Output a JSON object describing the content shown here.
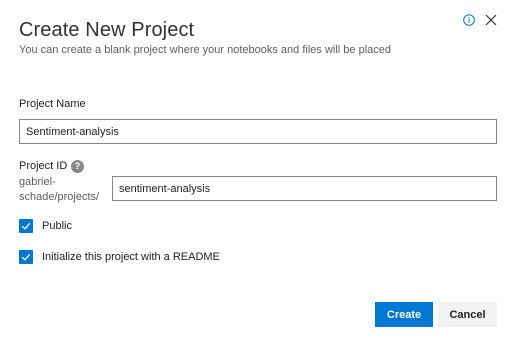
{
  "dialog": {
    "title": "Create New Project",
    "subtitle": "You can create a blank project where your notebooks and files will be placed",
    "info_icon": "info-icon",
    "close_icon": "close-icon"
  },
  "project_name": {
    "label": "Project Name",
    "value": "Sentiment-analysis"
  },
  "project_id": {
    "label": "Project ID",
    "help_icon": "help-icon",
    "help_glyph": "?",
    "prefix": "gabriel-schade/projects/",
    "value": "sentiment-analysis"
  },
  "options": {
    "public": {
      "label": "Public",
      "checked": true
    },
    "readme": {
      "label": "Initialize this project with a README",
      "checked": true
    }
  },
  "buttons": {
    "create": "Create",
    "cancel": "Cancel"
  },
  "colors": {
    "accent": "#0078d4",
    "secondary_button": "#f3f2f1",
    "border": "#8a8886"
  }
}
